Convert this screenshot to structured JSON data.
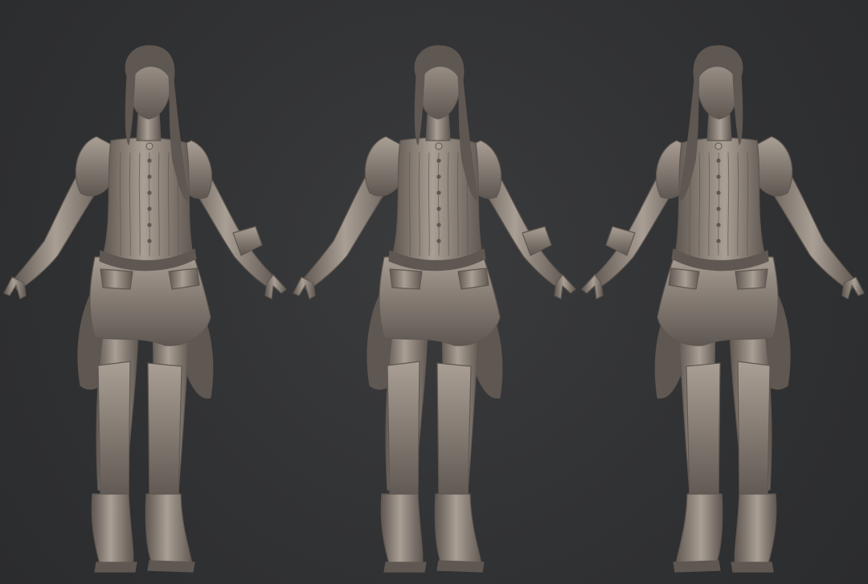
{
  "scene": {
    "background_color": "#313234",
    "clay_color": "#8b8178",
    "clay_shadow": "#5f5751",
    "clay_highlight": "#a99f95",
    "views": [
      {
        "name": "three-quarter-left",
        "mirrored": false
      },
      {
        "name": "front",
        "mirrored": false
      },
      {
        "name": "three-quarter-right",
        "mirrored": true
      }
    ]
  }
}
